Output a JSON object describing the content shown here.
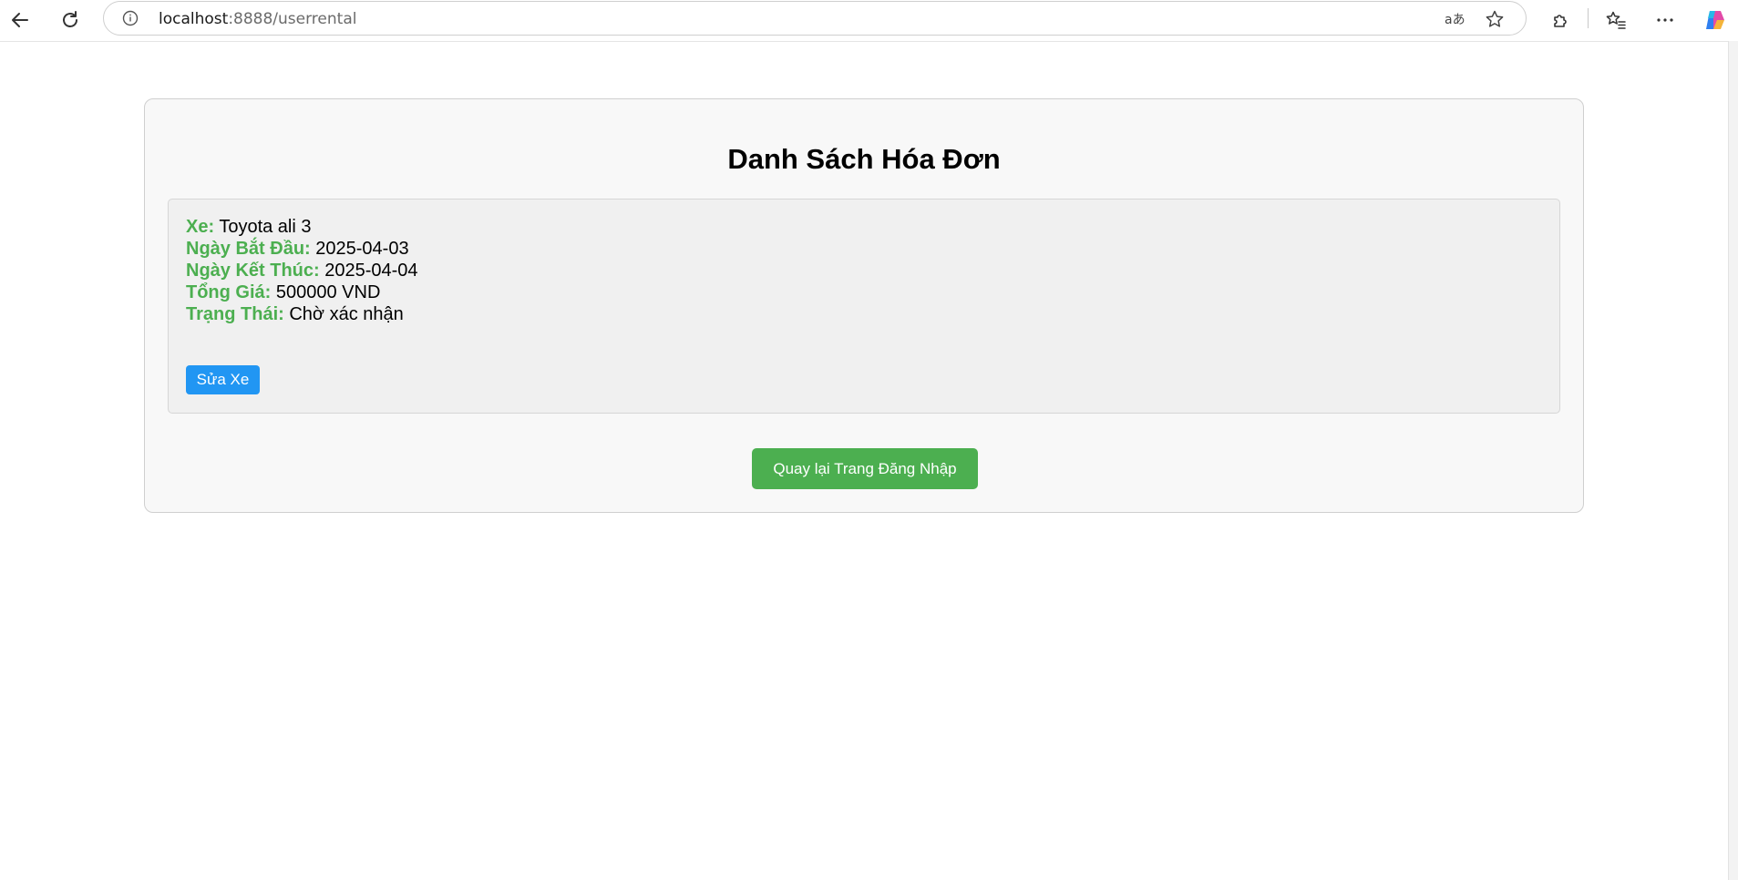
{
  "browser": {
    "url_host": "localhost",
    "url_rest": ":8888/userrental",
    "icons": {
      "back": "arrow-left-icon",
      "reload": "reload-icon",
      "site_info": "info-icon",
      "read_aloud": "read-aloud-icon",
      "favorite": "star-icon",
      "extensions": "puzzle-icon",
      "favorites_list": "favorites-list-icon",
      "more": "more-icon",
      "copilot": "copilot-icon"
    }
  },
  "page": {
    "title": "Danh Sách Hóa Đơn",
    "rentals": [
      {
        "car_label": "Xe:",
        "car_value": "Toyota ali 3",
        "start_label": "Ngày Bắt Đầu:",
        "start_value": "2025-04-03",
        "end_label": "Ngày Kết Thúc:",
        "end_value": "2025-04-04",
        "total_label": "Tổng Giá:",
        "total_value": "500000 VND",
        "status_label": "Trạng Thái:",
        "status_value": "Chờ xác nhận",
        "edit_button": "Sửa Xe"
      }
    ],
    "back_button": "Quay lại Trang Đăng Nhập"
  },
  "colors": {
    "label_green": "#4caf50",
    "edit_blue": "#2196f3",
    "back_green": "#4caf50"
  }
}
